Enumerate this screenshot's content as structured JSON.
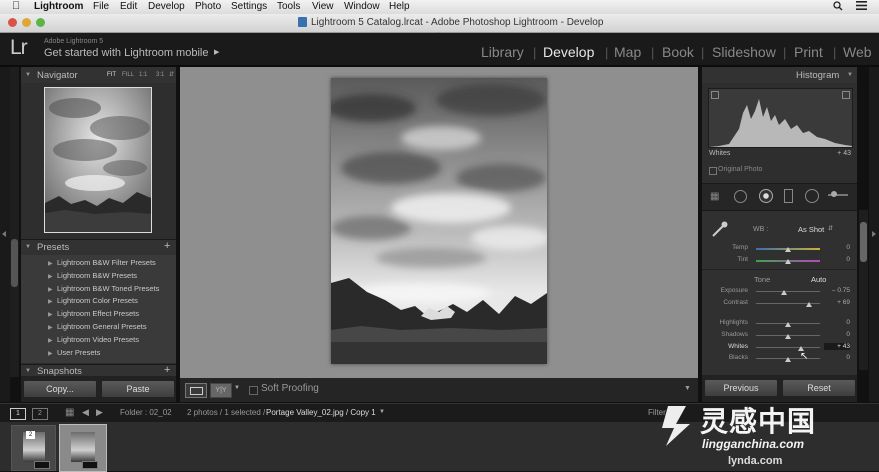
{
  "menubar": {
    "app": "Lightroom",
    "items": [
      "File",
      "Edit",
      "Develop",
      "Photo",
      "Settings",
      "Tools",
      "View",
      "Window",
      "Help"
    ]
  },
  "window": {
    "title": "Lightroom 5 Catalog.lrcat - Adobe Photoshop Lightroom - Develop"
  },
  "identity": {
    "logo": "Lr",
    "product": "Adobe Lightroom 5",
    "tagline": "Get started with Lightroom mobile",
    "modules": [
      "Library",
      "Develop",
      "Map",
      "Book",
      "Slideshow",
      "Print",
      "Web"
    ],
    "active_module": "Develop"
  },
  "navigator": {
    "title": "Navigator",
    "zoom_options": [
      "FIT",
      "FILL",
      "1:1",
      "3:1"
    ]
  },
  "presets": {
    "title": "Presets",
    "add": "+",
    "items": [
      "Lightroom B&W Filter Presets",
      "Lightroom B&W Presets",
      "Lightroom B&W Toned Presets",
      "Lightroom Color Presets",
      "Lightroom Effect Presets",
      "Lightroom General Presets",
      "Lightroom Video Presets",
      "User Presets"
    ]
  },
  "snapshots": {
    "title": "Snapshots",
    "add": "+"
  },
  "left_buttons": {
    "copy": "Copy...",
    "paste": "Paste"
  },
  "toolbar": {
    "view_label": "Y|Y",
    "soft_proofing": "Soft Proofing"
  },
  "histogram": {
    "title": "Histogram",
    "channel_label": "Whites",
    "channel_value": "+ 43",
    "original_photo": "Original Photo"
  },
  "basic": {
    "wb_label": "WB :",
    "wb_value": "As Shot",
    "tone_label": "Tone",
    "auto_label": "Auto",
    "sliders": [
      {
        "name": "Temp",
        "value": "0",
        "pos": 0.5
      },
      {
        "name": "Tint",
        "value": "0",
        "pos": 0.5
      },
      {
        "name": "Exposure",
        "value": "– 0.75",
        "pos": 0.44
      },
      {
        "name": "Contrast",
        "value": "+ 69",
        "pos": 0.83
      },
      {
        "name": "Highlights",
        "value": "0",
        "pos": 0.5
      },
      {
        "name": "Shadows",
        "value": "0",
        "pos": 0.5
      },
      {
        "name": "Whites",
        "value": "+ 43",
        "pos": 0.71
      },
      {
        "name": "Blacks",
        "value": "0",
        "pos": 0.5
      }
    ]
  },
  "right_buttons": {
    "previous": "Previous",
    "reset": "Reset"
  },
  "filmstrip": {
    "screen1": "1",
    "screen2": "2",
    "folder": "Folder : 02_02",
    "info_prefix": "2 photos / 1 selected /",
    "info_file": "Portage Valley_02.jpg / Copy 1",
    "filter": "Filter :",
    "thumb_badge": "2"
  },
  "watermark": {
    "cn": "灵感中国",
    "url": "lingganchina.com",
    "lynda": "lynda.com"
  },
  "colors": {
    "accent_active": "#e8e8e8",
    "panel_bg": "#2b2b2b",
    "canvas_bg": "#8f8f8f",
    "temp_gradient_start": "#3d6ea8",
    "temp_gradient_end": "#c9b23a",
    "tint_gradient_start": "#3fa24a",
    "tint_gradient_end": "#b548b8"
  }
}
